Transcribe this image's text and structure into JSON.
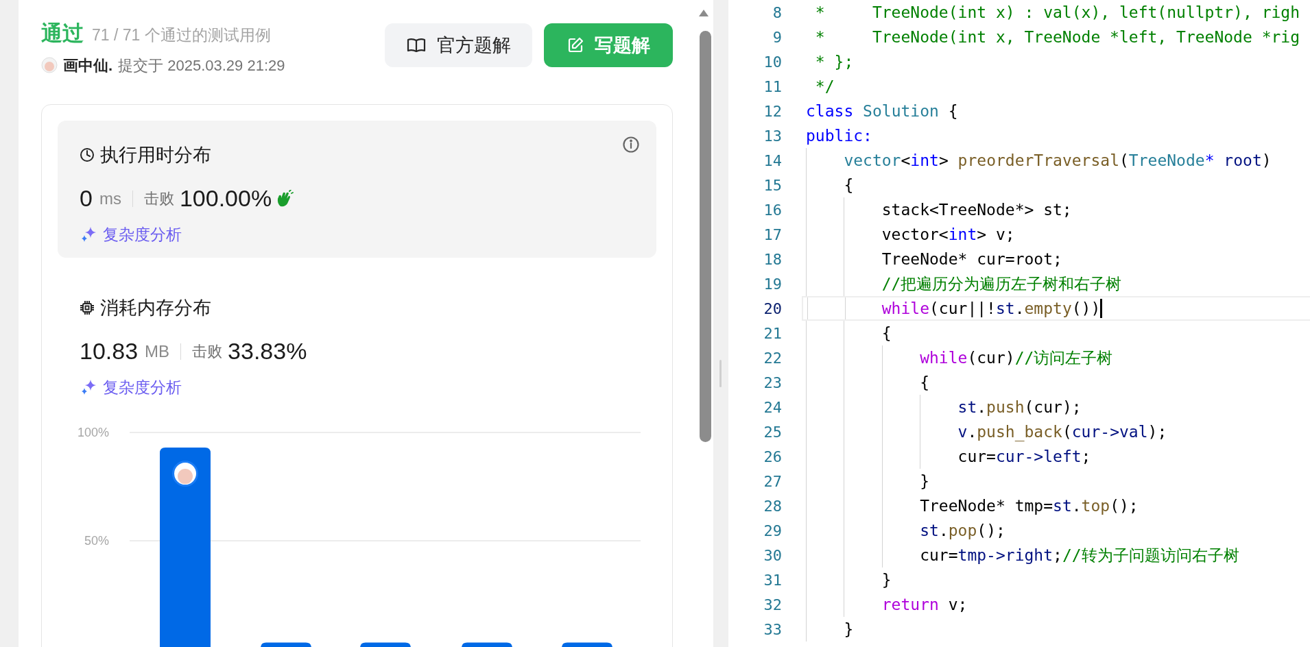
{
  "result": {
    "status": "通过",
    "cases": "71 / 71 个通过的测试用例"
  },
  "submitter": {
    "name": "画中仙.",
    "submitted": "提交于 2025.03.29 21:29"
  },
  "buttons": [
    {
      "label": "官方题解",
      "kind": "secondary"
    },
    {
      "label": "写题解",
      "kind": "primary"
    }
  ],
  "metrics": [
    {
      "kind": "runtime",
      "selected": true,
      "title": "执行用时分布",
      "value": "0",
      "unit": "ms",
      "beats_label": "击败",
      "beats": "100.00%",
      "analysis": "复杂度分析"
    },
    {
      "kind": "memory",
      "selected": false,
      "title": "消耗内存分布",
      "value": "10.83",
      "unit": "MB",
      "beats_label": "击败",
      "beats": "33.83%",
      "analysis": "复杂度分析"
    }
  ],
  "distribution": {
    "chart_data": {
      "type": "bar",
      "ylim": [
        0,
        100
      ],
      "yticks": [
        {
          "value": 50,
          "label": "50%"
        },
        {
          "value": 100,
          "label": "100%"
        }
      ],
      "series": [
        {
          "color": "#0069e6",
          "values": [
            93,
            3,
            3,
            3,
            3
          ]
        }
      ]
    }
  },
  "editor": {
    "lines": [
      {
        "number": "8",
        "current": false,
        "tokens": [
          {
            "text": " *     TreeNode(int x) : val(x), left(nullptr), righ",
            "kind": "comment"
          }
        ]
      },
      {
        "number": "9",
        "current": false,
        "tokens": [
          {
            "text": " *     TreeNode(int x, TreeNode *left, TreeNode *rig",
            "kind": "comment"
          }
        ]
      },
      {
        "number": "10",
        "current": false,
        "tokens": [
          {
            "text": " * };",
            "kind": "comment"
          }
        ]
      },
      {
        "number": "11",
        "current": false,
        "tokens": [
          {
            "text": " */",
            "kind": "comment"
          }
        ]
      },
      {
        "number": "12",
        "current": false,
        "tokens": [
          {
            "text": "class",
            "kind": "keyword"
          },
          {
            "text": " Solution",
            "kind": "type"
          },
          {
            "text": " {",
            "kind": "plain"
          }
        ]
      },
      {
        "number": "13",
        "current": false,
        "tokens": [
          {
            "text": "public:",
            "kind": "keyword"
          }
        ]
      },
      {
        "number": "14",
        "current": false,
        "tokens": [
          {
            "text": "    vector",
            "kind": "type"
          },
          {
            "text": "<",
            "kind": "plain"
          },
          {
            "text": "int",
            "kind": "keyword"
          },
          {
            "text": "> ",
            "kind": "plain"
          },
          {
            "text": "preorderTraversal",
            "kind": "function"
          },
          {
            "text": "(",
            "kind": "plain"
          },
          {
            "text": "TreeNode",
            "kind": "type"
          },
          {
            "text": "*",
            "kind": "keyword"
          },
          {
            "text": " root",
            "kind": "variable"
          },
          {
            "text": ")",
            "kind": "plain"
          }
        ]
      },
      {
        "number": "15",
        "current": false,
        "tokens": [
          {
            "text": "    {",
            "kind": "plain"
          }
        ]
      },
      {
        "number": "16",
        "current": false,
        "tokens": [
          {
            "text": "        stack<TreeNode*> st;",
            "kind": "plain"
          }
        ]
      },
      {
        "number": "17",
        "current": false,
        "tokens": [
          {
            "text": "        vector<",
            "kind": "plain"
          },
          {
            "text": "int",
            "kind": "keyword"
          },
          {
            "text": "> v;",
            "kind": "plain"
          }
        ]
      },
      {
        "number": "18",
        "current": false,
        "tokens": [
          {
            "text": "        TreeNode* cur=root;",
            "kind": "plain"
          }
        ]
      },
      {
        "number": "19",
        "current": false,
        "tokens": [
          {
            "text": "        //把遍历分为遍历左子树和右子树",
            "kind": "comment"
          }
        ]
      },
      {
        "number": "20",
        "current": true,
        "tokens": [
          {
            "text": "        while",
            "kind": "control"
          },
          {
            "text": "(cur||!",
            "kind": "plain"
          },
          {
            "text": "st",
            "kind": "variable"
          },
          {
            "text": ".",
            "kind": "plain"
          },
          {
            "text": "empty",
            "kind": "function"
          },
          {
            "text": "())",
            "kind": "plain"
          }
        ]
      },
      {
        "number": "21",
        "current": false,
        "tokens": [
          {
            "text": "        {",
            "kind": "plain"
          }
        ]
      },
      {
        "number": "22",
        "current": false,
        "tokens": [
          {
            "text": "            while",
            "kind": "control"
          },
          {
            "text": "(cur)",
            "kind": "plain"
          },
          {
            "text": "//访问左子树",
            "kind": "comment"
          }
        ]
      },
      {
        "number": "23",
        "current": false,
        "tokens": [
          {
            "text": "            {",
            "kind": "plain"
          }
        ]
      },
      {
        "number": "24",
        "current": false,
        "tokens": [
          {
            "text": "                st",
            "kind": "variable"
          },
          {
            "text": ".",
            "kind": "plain"
          },
          {
            "text": "push",
            "kind": "function"
          },
          {
            "text": "(cur);",
            "kind": "plain"
          }
        ]
      },
      {
        "number": "25",
        "current": false,
        "tokens": [
          {
            "text": "                v",
            "kind": "variable"
          },
          {
            "text": ".",
            "kind": "plain"
          },
          {
            "text": "push_back",
            "kind": "function"
          },
          {
            "text": "(",
            "kind": "plain"
          },
          {
            "text": "cur->val",
            "kind": "variable"
          },
          {
            "text": ");",
            "kind": "plain"
          }
        ]
      },
      {
        "number": "26",
        "current": false,
        "tokens": [
          {
            "text": "                cur=",
            "kind": "plain"
          },
          {
            "text": "cur->left",
            "kind": "variable"
          },
          {
            "text": ";",
            "kind": "plain"
          }
        ]
      },
      {
        "number": "27",
        "current": false,
        "tokens": [
          {
            "text": "            }",
            "kind": "plain"
          }
        ]
      },
      {
        "number": "28",
        "current": false,
        "tokens": [
          {
            "text": "            TreeNode* tmp=",
            "kind": "plain"
          },
          {
            "text": "st",
            "kind": "variable"
          },
          {
            "text": ".",
            "kind": "plain"
          },
          {
            "text": "top",
            "kind": "function"
          },
          {
            "text": "();",
            "kind": "plain"
          }
        ]
      },
      {
        "number": "29",
        "current": false,
        "tokens": [
          {
            "text": "            st",
            "kind": "variable"
          },
          {
            "text": ".",
            "kind": "plain"
          },
          {
            "text": "pop",
            "kind": "function"
          },
          {
            "text": "();",
            "kind": "plain"
          }
        ]
      },
      {
        "number": "30",
        "current": false,
        "tokens": [
          {
            "text": "            cur=",
            "kind": "plain"
          },
          {
            "text": "tmp->right",
            "kind": "variable"
          },
          {
            "text": ";",
            "kind": "plain"
          },
          {
            "text": "//转为子问题访问右子树",
            "kind": "comment"
          }
        ]
      },
      {
        "number": "31",
        "current": false,
        "tokens": [
          {
            "text": "        }",
            "kind": "plain"
          }
        ]
      },
      {
        "number": "32",
        "current": false,
        "tokens": [
          {
            "text": "        return",
            "kind": "control"
          },
          {
            "text": " v;",
            "kind": "plain"
          }
        ]
      },
      {
        "number": "33",
        "current": false,
        "tokens": [
          {
            "text": "    }",
            "kind": "plain"
          }
        ]
      }
    ]
  }
}
